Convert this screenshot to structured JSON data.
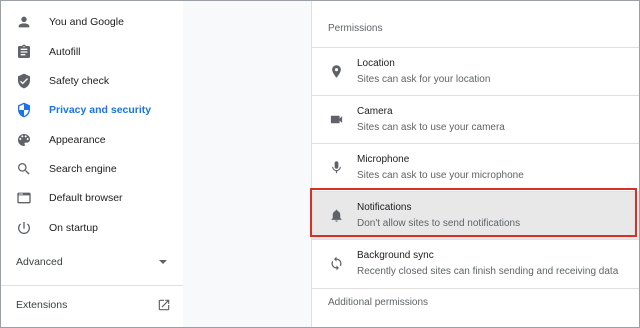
{
  "sidebar": {
    "items": [
      {
        "label": "You and Google",
        "icon": "person-icon"
      },
      {
        "label": "Autofill",
        "icon": "clipboard-icon"
      },
      {
        "label": "Safety check",
        "icon": "shield-check-icon"
      },
      {
        "label": "Privacy and security",
        "icon": "shield-icon",
        "active": true
      },
      {
        "label": "Appearance",
        "icon": "palette-icon"
      },
      {
        "label": "Search engine",
        "icon": "search-icon"
      },
      {
        "label": "Default browser",
        "icon": "browser-icon"
      },
      {
        "label": "On startup",
        "icon": "power-icon"
      }
    ],
    "advanced_label": "Advanced",
    "extensions_label": "Extensions"
  },
  "permissions": {
    "section_title": "Permissions",
    "rows": [
      {
        "title": "Location",
        "subtitle": "Sites can ask for your location",
        "icon": "location-pin-icon"
      },
      {
        "title": "Camera",
        "subtitle": "Sites can ask to use your camera",
        "icon": "camera-icon"
      },
      {
        "title": "Microphone",
        "subtitle": "Sites can ask to use your microphone",
        "icon": "microphone-icon"
      },
      {
        "title": "Notifications",
        "subtitle": "Don't allow sites to send notifications",
        "icon": "bell-icon",
        "highlighted": true
      },
      {
        "title": "Background sync",
        "subtitle": "Recently closed sites can finish sending and receiving data",
        "icon": "sync-icon"
      }
    ],
    "additional_label": "Additional permissions"
  },
  "colors": {
    "accent": "#1a73e8",
    "highlight_border": "#d93025",
    "highlight_fill": "#e8e8e8"
  }
}
